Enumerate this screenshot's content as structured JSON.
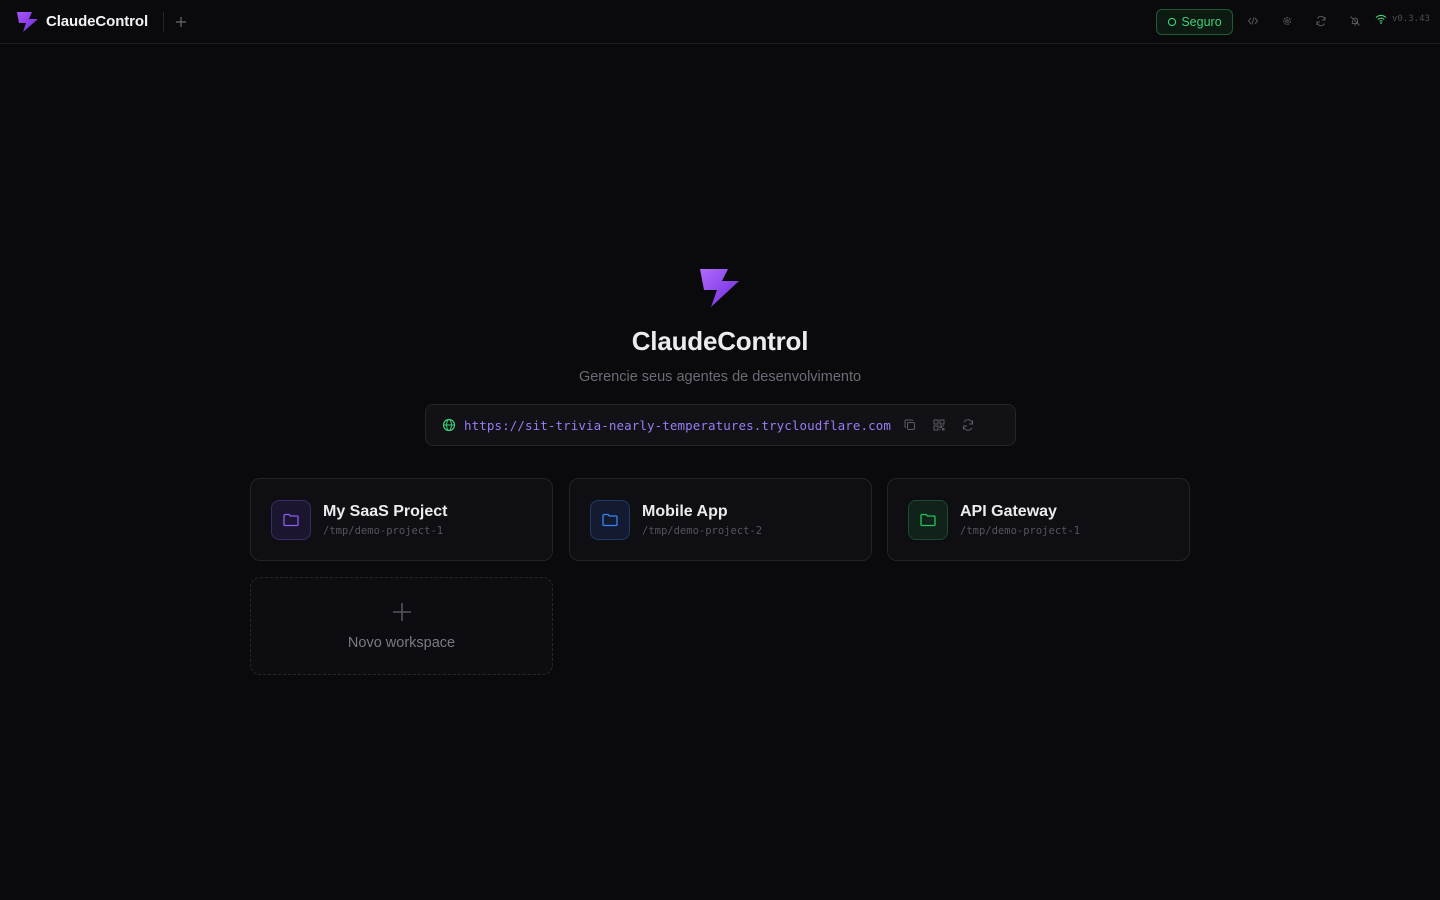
{
  "app": {
    "name": "ClaudeControl",
    "version": "v0.3.43"
  },
  "topbar": {
    "status_label": "Seguro",
    "icons": [
      "add-tab-icon",
      "code-icon",
      "settings-icon",
      "refresh-icon",
      "bell-off-icon",
      "wifi-icon"
    ]
  },
  "hero": {
    "title": "ClaudeControl",
    "subtitle": "Gerencie seus agentes de desenvolvimento",
    "url": "https://sit-trivia-nearly-temperatures.trycloudflare.com"
  },
  "workspaces": [
    {
      "name": "My SaaS Project",
      "path": "/tmp/demo-project-1",
      "color": "#8b5cf6"
    },
    {
      "name": "Mobile App",
      "path": "/tmp/demo-project-2",
      "color": "#3b82f6"
    },
    {
      "name": "API Gateway",
      "path": "/tmp/demo-project-1",
      "color": "#22c55e"
    }
  ],
  "new_workspace_label": "Novo workspace",
  "colors": {
    "accent": "#9b7bf5",
    "success": "#3fd07a",
    "background": "#0a0a0c"
  }
}
